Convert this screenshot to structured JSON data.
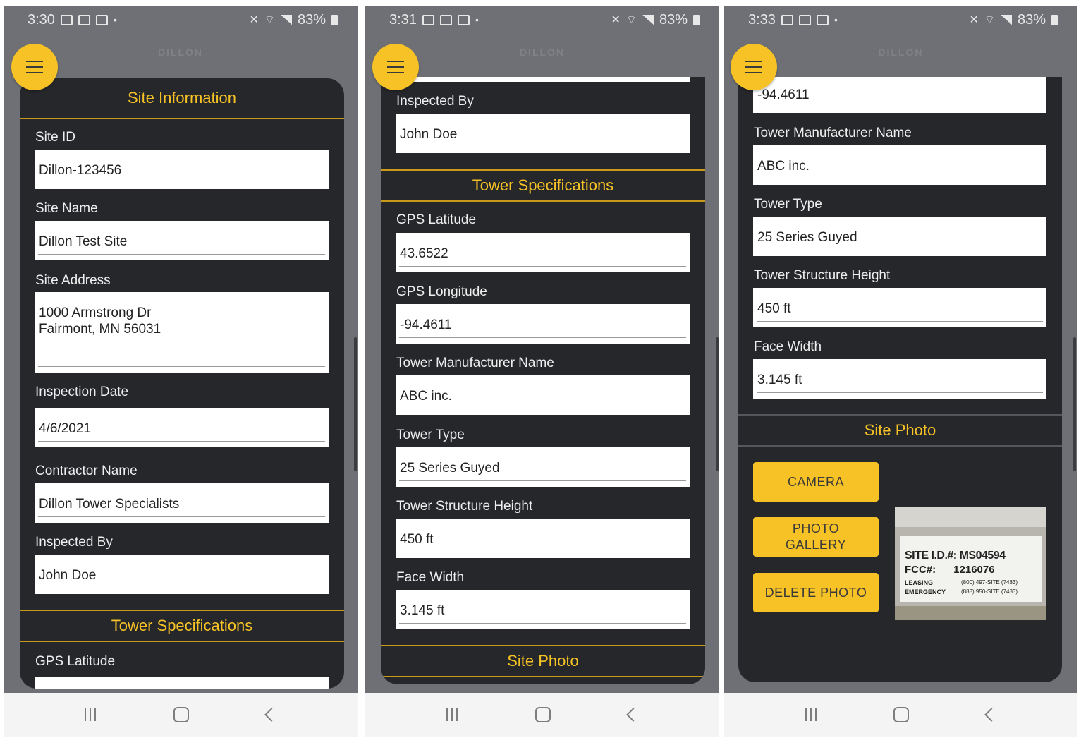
{
  "brand": "DILLON",
  "colors": {
    "accent": "#f6c225",
    "card": "#26272b",
    "background": "#6e7076"
  },
  "icons": {
    "menu": "hamburger-icon",
    "battery": "battery-icon",
    "wifi": "wifi-icon",
    "mute": "mute-icon",
    "signal": "signal-icon"
  },
  "screen1": {
    "status": {
      "time": "3:30",
      "battery": "83%"
    },
    "section_site_info": "Site Information",
    "fields": [
      {
        "label": "Site ID",
        "value": "Dillon-123456"
      },
      {
        "label": "Site Name",
        "value": "Dillon Test Site"
      },
      {
        "label": "Site Address",
        "value": "1000 Armstrong Dr\nFairmont, MN 56031"
      },
      {
        "label": "Inspection Date",
        "value": "4/6/2021"
      },
      {
        "label": "Contractor Name",
        "value": "Dillon Tower Specialists"
      },
      {
        "label": "Inspected By",
        "value": "John Doe"
      }
    ],
    "section_tower": "Tower Specifications",
    "last_label": "GPS Latitude"
  },
  "screen2": {
    "status": {
      "time": "3:31",
      "battery": "83%"
    },
    "inspected_by": {
      "label": "Inspected By",
      "value": "John Doe"
    },
    "section_tower": "Tower Specifications",
    "fields": [
      {
        "label": "GPS Latitude",
        "value": "43.6522"
      },
      {
        "label": "GPS Longitude",
        "value": "-94.4611"
      },
      {
        "label": "Tower Manufacturer Name",
        "value": "ABC inc."
      },
      {
        "label": "Tower Type",
        "value": "25 Series Guyed"
      },
      {
        "label": "Tower Structure Height",
        "value": "450 ft"
      },
      {
        "label": "Face Width",
        "value": "3.145 ft"
      }
    ],
    "section_photo": "Site Photo"
  },
  "screen3": {
    "status": {
      "time": "3:33",
      "battery": "83%"
    },
    "top_value": "-94.4611",
    "fields": [
      {
        "label": "Tower Manufacturer Name",
        "value": "ABC inc."
      },
      {
        "label": "Tower Type",
        "value": "25 Series Guyed"
      },
      {
        "label": "Tower Structure Height",
        "value": "450 ft"
      },
      {
        "label": "Face Width",
        "value": "3.145 ft"
      }
    ],
    "section_photo": "Site Photo",
    "buttons": {
      "camera": "CAMERA",
      "gallery": "PHOTO\nGALLERY",
      "delete": "DELETE PHOTO"
    },
    "photo_sign": {
      "line1": "SITE I.D.#: MS04594",
      "line2": "FCC#:      1216076",
      "line3_label": "LEASING",
      "line3_value": "(800) 497-SITE (7483)",
      "line4_label": "EMERGENCY",
      "line4_value": "(888) 950-SITE (7483)"
    }
  }
}
